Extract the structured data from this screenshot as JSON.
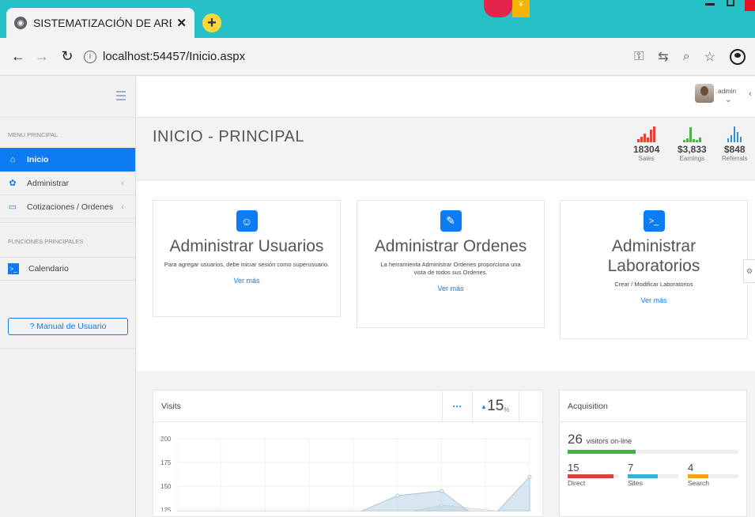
{
  "browser": {
    "tab_title": "SISTEMATIZACIÓN DE AREA DE /",
    "tab_close": "✕",
    "new_tab": "+",
    "url": "localhost:54457/Inicio.aspx",
    "accent": "#26c0c7"
  },
  "topbar": {
    "user": "admin"
  },
  "sidebar": {
    "menu_heading": "MENU PRINCIPAL",
    "items": [
      {
        "label": "Inicio",
        "icon": "home-icon",
        "active": true
      },
      {
        "label": "Administrar",
        "icon": "gear-icon",
        "active": false
      },
      {
        "label": "Cotizaciones / Ordenes",
        "icon": "folder-icon",
        "active": false
      }
    ],
    "functions_heading": "FUNCIONES PRINCIPALES",
    "calendar_label": "Calendario",
    "manual_button": "? Manual de Usuario"
  },
  "header": {
    "title": "INICIO - PRINCIPAL",
    "stats": [
      {
        "value": "18304",
        "label": "Sales",
        "color": "#e0453a"
      },
      {
        "value": "$3,833",
        "label": "Earnings",
        "color": "#4caf50"
      },
      {
        "value": "$848",
        "label": "Referrals",
        "color": "#2f8ee6"
      }
    ]
  },
  "cards": [
    {
      "title": "Administrar Usuarios",
      "desc": "Para agregar usuarios, debe iniciar sesión como superusuario.",
      "link": "Ver más",
      "icon": "smiley-icon"
    },
    {
      "title": "Administrar Ordenes",
      "desc": "La herramienta Administrar Ordenes proporciona una vista de todos sus Ordenes.",
      "link": "Ver más",
      "icon": "paperclip-icon"
    },
    {
      "title": "Administrar Laboratorios",
      "desc": "Crear / Modificar Laboratorios",
      "link": "Ver más",
      "icon": "terminal-icon"
    }
  ],
  "visits": {
    "title": "Visits",
    "menu": "···",
    "percent": "15",
    "percent_unit": "%"
  },
  "acquisition": {
    "title": "Acquisition",
    "online_count": "26",
    "online_label": "visitors on-line",
    "online_fraction": 0.4,
    "sources": [
      {
        "count": "15",
        "label": "Direct",
        "color": "#d9413a",
        "fraction": 0.9
      },
      {
        "count": "7",
        "label": "Sites",
        "color": "#3bb0d6",
        "fraction": 0.6
      },
      {
        "count": "4",
        "label": "Search",
        "color": "#f2a31b",
        "fraction": 0.4
      }
    ]
  },
  "chart_data": {
    "type": "area",
    "y_ticks": [
      "200",
      "175",
      "150",
      "125"
    ],
    "ylim": [
      120,
      205
    ],
    "series": [
      {
        "values": [
          110,
          112,
          115,
          118,
          120,
          140,
          145,
          110,
          160
        ],
        "color": "#a9c7dd"
      },
      {
        "values": [
          105,
          108,
          110,
          112,
          115,
          120,
          130,
          125,
          118
        ],
        "color": "#d7dde2"
      }
    ]
  }
}
